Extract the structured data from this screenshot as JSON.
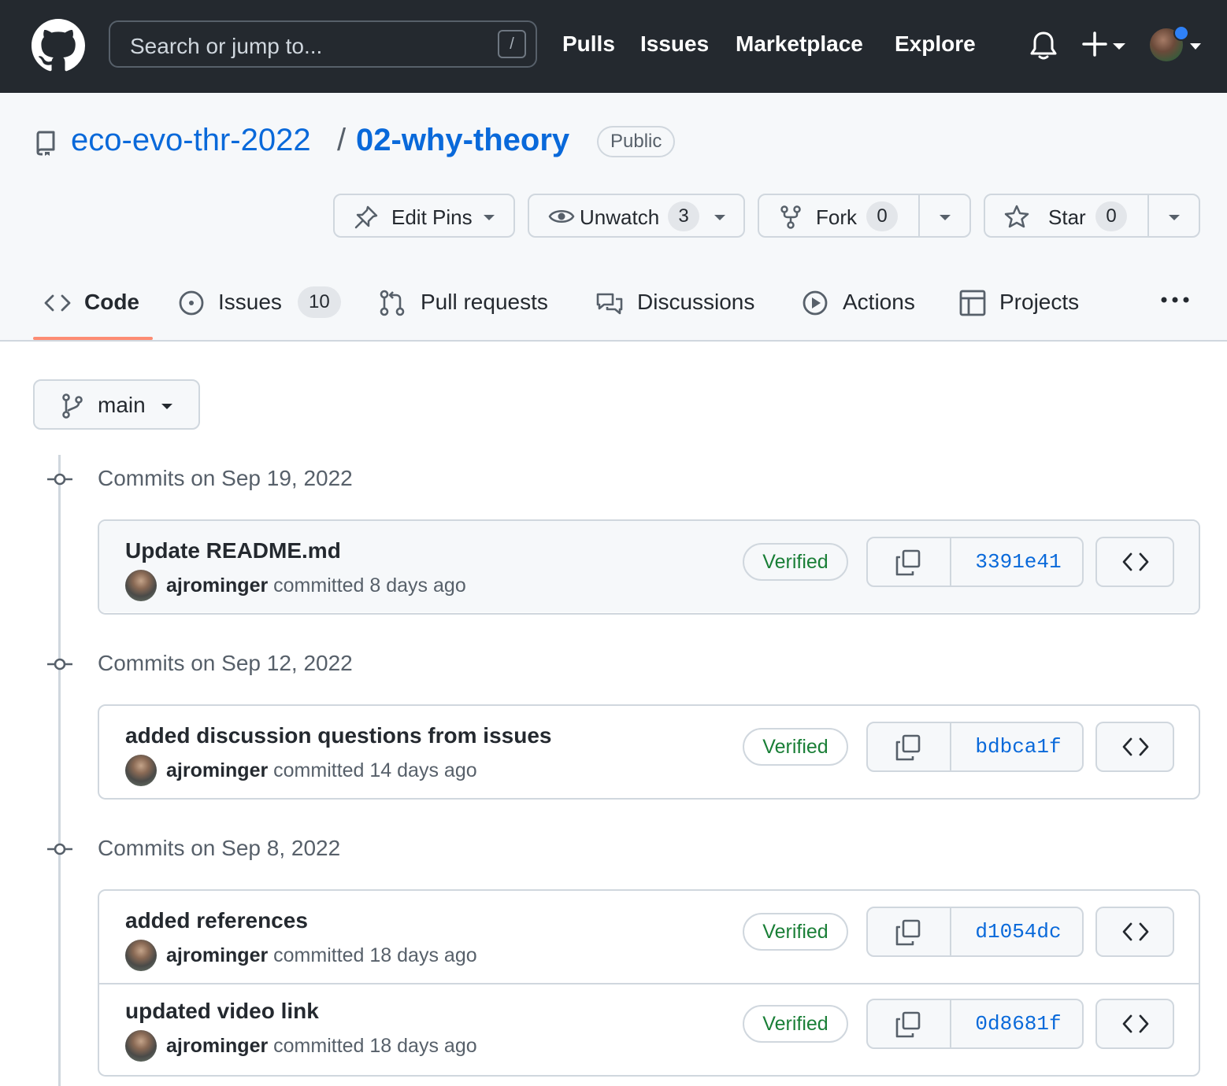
{
  "header": {
    "search_placeholder": "Search or jump to...",
    "search_shortcut": "/",
    "nav": [
      "Pulls",
      "Issues",
      "Marketplace",
      "Explore"
    ],
    "icons": [
      "github-logo",
      "bell-icon",
      "plus-icon",
      "avatar"
    ]
  },
  "repo": {
    "owner": "eco-evo-thr-2022",
    "separator": "/",
    "name": "02-why-theory",
    "visibility": "Public",
    "edit_pins_label": "Edit Pins",
    "unwatch_label": "Unwatch",
    "watch_count": "3",
    "fork_label": "Fork",
    "fork_count": "0",
    "star_label": "Star",
    "star_count": "0"
  },
  "tabs": {
    "code": "Code",
    "issues": "Issues",
    "issues_count": "10",
    "pulls": "Pull requests",
    "discussions": "Discussions",
    "actions": "Actions",
    "projects": "Projects",
    "active": "Code",
    "accent_color": "#fd8c73"
  },
  "branch": {
    "name": "main"
  },
  "commit_days": [
    {
      "heading": "Commits on Sep 19, 2022",
      "commits": [
        {
          "title": "Update README.md",
          "author": "ajrominger",
          "meta": " committed 8 days ago",
          "verified": "Verified",
          "sha": "3391e41"
        }
      ]
    },
    {
      "heading": "Commits on Sep 12, 2022",
      "commits": [
        {
          "title": "added discussion questions from issues",
          "author": "ajrominger",
          "meta": " committed 14 days ago",
          "verified": "Verified",
          "sha": "bdbca1f"
        }
      ]
    },
    {
      "heading": "Commits on Sep 8, 2022",
      "commits": [
        {
          "title": "added references",
          "author": "ajrominger",
          "meta": " committed 18 days ago",
          "verified": "Verified",
          "sha": "d1054dc"
        },
        {
          "title": "updated video link",
          "author": "ajrominger",
          "meta": " committed 18 days ago",
          "verified": "Verified",
          "sha": "0d8681f"
        }
      ]
    }
  ],
  "colors": {
    "link": "#0969da",
    "verified": "#1a7f37",
    "header_bg": "#24292f",
    "notification_dot": "#2f81f7"
  }
}
